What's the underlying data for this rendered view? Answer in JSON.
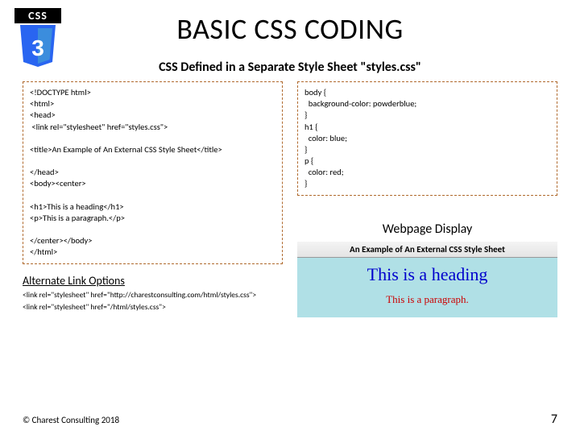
{
  "logo": {
    "top_text": "CSS",
    "glyph": "3"
  },
  "title": "BASIC CSS CODING",
  "subtitle": "CSS Defined in a Separate Style Sheet \"styles.css\"",
  "left_code": "<!DOCTYPE html>\n<html>\n<head>\n <link rel=\"stylesheet\" href=\"styles.css\">\n\n<title>An Example of An External CSS Style Sheet</title>\n\n</head>\n<body><center>\n\n<h1>This is a heading</h1>\n<p>This is a paragraph.</p>\n\n</center></body>\n</html>",
  "right_code": "body {\n  background-color: powderblue;\n}\nh1 {\n  color: blue;\n}\np {\n  color: red;\n}",
  "alt_heading": "Alternate Link Options",
  "alt_line1": "<link rel=\"stylesheet\" href=\"http://charestconsulting.com/html/styles.css\">",
  "alt_line2": "<link rel=\"stylesheet\" href=\"/html/styles.css\">",
  "webdisplay_label": "Webpage Display",
  "preview": {
    "tab_title": "An Example of An External CSS Style Sheet",
    "heading": "This is a heading",
    "paragraph": "This is a paragraph."
  },
  "footer_left": "© Charest Consulting 2018",
  "page_number": "7"
}
